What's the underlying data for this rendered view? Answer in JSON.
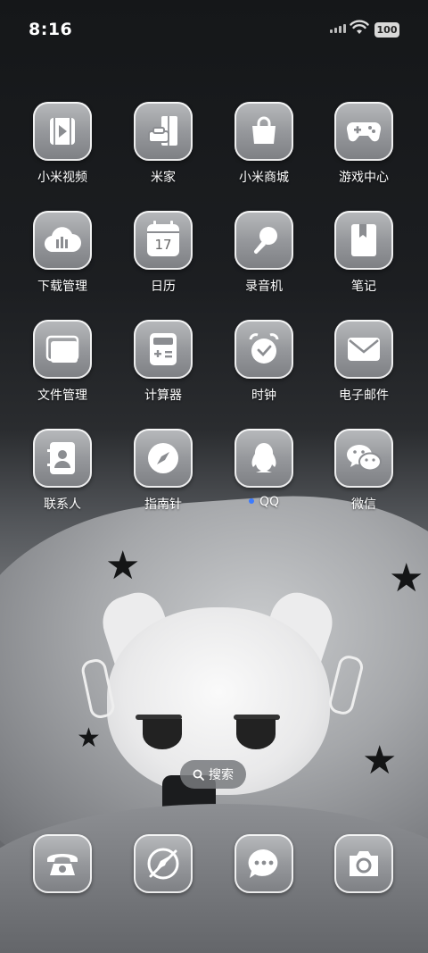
{
  "status_bar": {
    "time": "8:16",
    "battery": "100"
  },
  "apps": [
    {
      "label": "小米视频",
      "icon": "video-play-icon"
    },
    {
      "label": "米家",
      "icon": "home-sofa-icon"
    },
    {
      "label": "小米商城",
      "icon": "shopping-bag-icon"
    },
    {
      "label": "游戏中心",
      "icon": "gamepad-icon"
    },
    {
      "label": "下载管理",
      "icon": "cloud-download-icon"
    },
    {
      "label": "日历",
      "icon": "calendar-icon",
      "date": "17"
    },
    {
      "label": "录音机",
      "icon": "microphone-icon"
    },
    {
      "label": "笔记",
      "icon": "notebook-icon"
    },
    {
      "label": "文件管理",
      "icon": "folder-icon"
    },
    {
      "label": "计算器",
      "icon": "calculator-icon"
    },
    {
      "label": "时钟",
      "icon": "alarm-clock-icon"
    },
    {
      "label": "电子邮件",
      "icon": "envelope-icon"
    },
    {
      "label": "联系人",
      "icon": "contacts-icon"
    },
    {
      "label": "指南针",
      "icon": "compass-icon"
    },
    {
      "label": "QQ",
      "icon": "qq-penguin-icon",
      "notify_dot_color": "#3b7bff"
    },
    {
      "label": "微信",
      "icon": "wechat-icon"
    }
  ],
  "search": {
    "label": "搜索"
  },
  "dock": [
    {
      "icon": "phone-icon"
    },
    {
      "icon": "browser-compass-icon"
    },
    {
      "icon": "messages-icon"
    },
    {
      "icon": "camera-icon"
    }
  ]
}
